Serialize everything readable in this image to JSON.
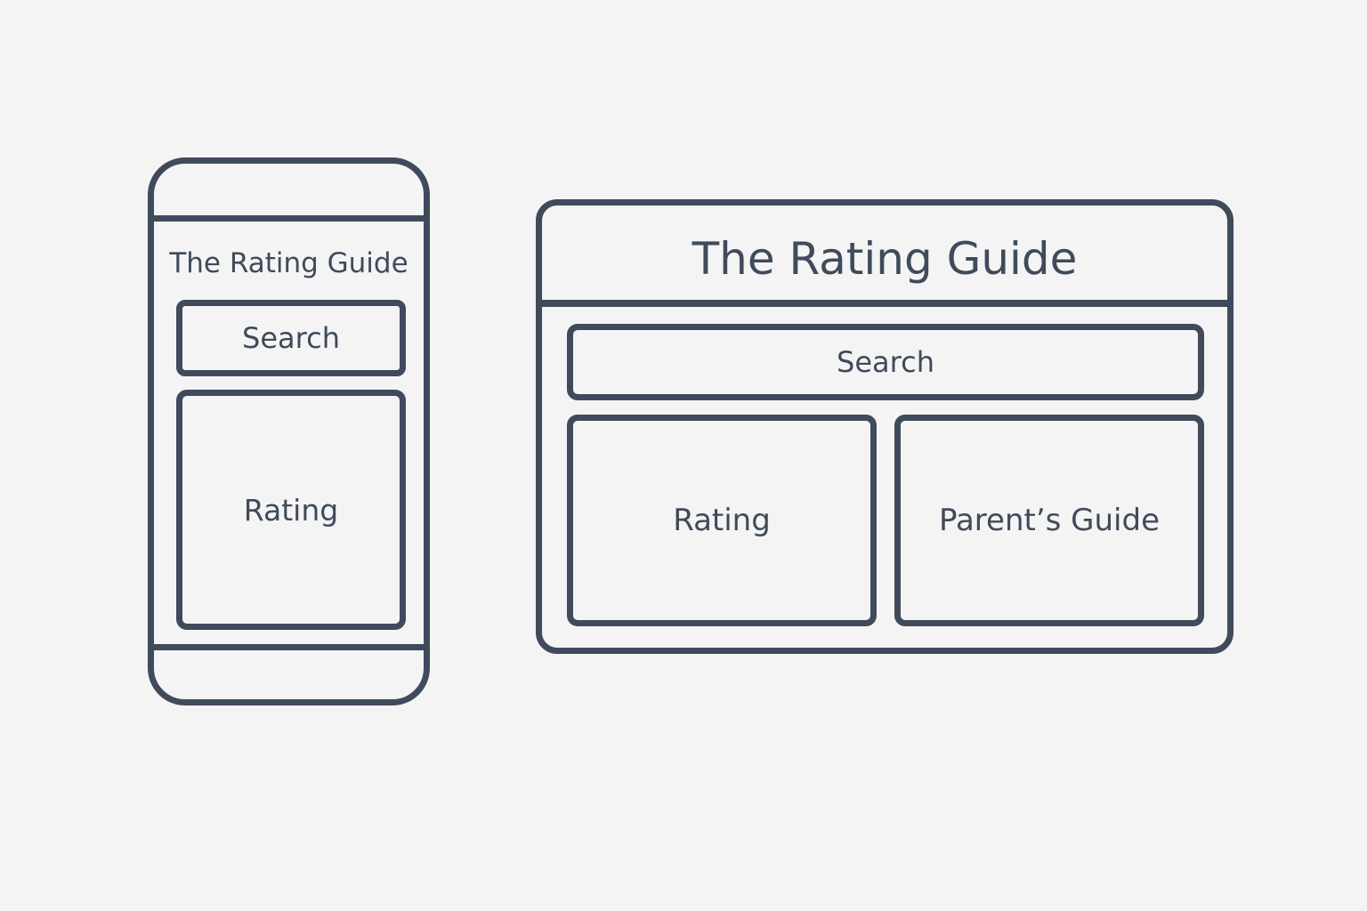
{
  "mobile": {
    "title": "The Rating Guide",
    "search_label": "Search",
    "rating_label": "Rating"
  },
  "desktop": {
    "title": "The Rating Guide",
    "search_label": "Search",
    "rating_label": "Rating",
    "parents_guide_label": "Parent’s Guide"
  },
  "colors": {
    "background": "#f4f4f4",
    "stroke": "#3f4b5b",
    "text": "#3f4b5b"
  }
}
